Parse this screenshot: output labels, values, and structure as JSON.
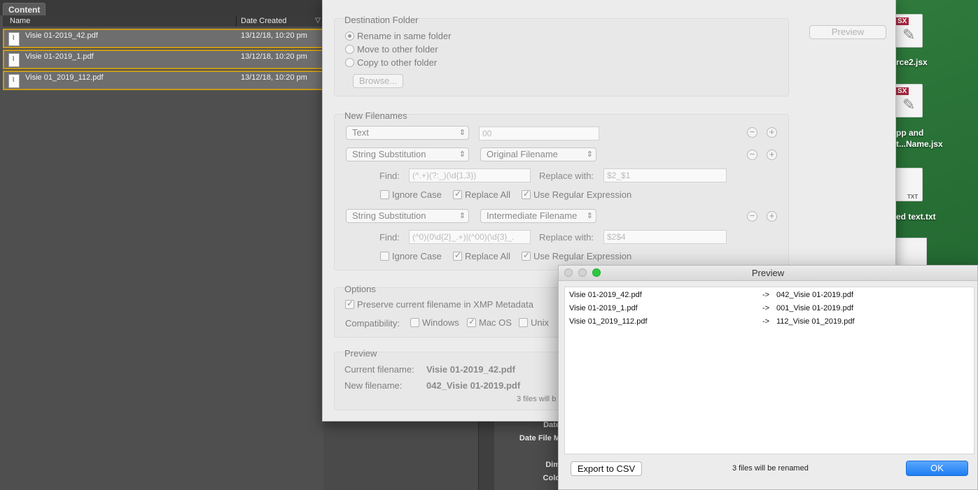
{
  "content_panel": {
    "tab": "Content",
    "columns": {
      "name": "Name",
      "date": "Date Created"
    },
    "files": [
      {
        "name": "Visie 01-2019_42.pdf",
        "date": "13/12/18, 10:20 pm"
      },
      {
        "name": "Visie 01-2019_1.pdf",
        "date": "13/12/18, 10:20 pm"
      },
      {
        "name": "Visie 01_2019_112.pdf",
        "date": "13/12/18, 10:20 pm"
      }
    ]
  },
  "rename_dialog": {
    "destination": {
      "title": "Destination Folder",
      "options": [
        "Rename in same folder",
        "Move to other folder",
        "Copy to other folder"
      ],
      "selected": "Rename in same folder",
      "browse_label": "Browse..."
    },
    "preview_button": "Preview",
    "new_filenames": {
      "title": "New Filenames",
      "rows": [
        {
          "element": "Text",
          "value": "00"
        },
        {
          "element": "String Substitution",
          "source": "Original Filename",
          "find_label": "Find:",
          "find": "(^.+)(?:_)(\\d{1,3})",
          "replace_label": "Replace with:",
          "replace": "$2_$1",
          "ignore_case": "Ignore Case",
          "replace_all": "Replace All",
          "use_regex": "Use Regular Expression"
        },
        {
          "element": "String Substitution",
          "source": "Intermediate Filename",
          "find_label": "Find:",
          "find": "(^0)(0\\d{2}_.+)|(^00)(\\d{3}_.",
          "replace_label": "Replace with:",
          "replace": "$2$4",
          "ignore_case": "Ignore Case",
          "replace_all": "Replace All",
          "use_regex": "Use Regular Expression"
        }
      ],
      "minus_symbol": "−",
      "plus_symbol": "+"
    },
    "options": {
      "title": "Options",
      "preserve_xmp": "Preserve current filename in XMP Metadata",
      "compatibility_label": "Compatibility:",
      "windows": "Windows",
      "macos": "Mac OS",
      "unix": "Unix"
    },
    "preview_section": {
      "title": "Preview",
      "current_label": "Current filename:",
      "current_value": "Visie 01-2019_42.pdf",
      "new_label": "New filename:",
      "new_value": "042_Visie 01-2019.pdf",
      "count_text": "3 files will b"
    }
  },
  "metadata_panel": {
    "labels": [
      "Date",
      "Date File M",
      "I",
      "Dim",
      "Colo"
    ]
  },
  "desktop": {
    "icons": [
      {
        "tag": "SX",
        "label": "rce2.jsx"
      },
      {
        "tag": "SX",
        "label_line1": "pp and",
        "label_line2": "t...Name.jsx"
      },
      {
        "tag": "TXT",
        "label": "ed text.txt"
      }
    ]
  },
  "preview_window": {
    "title": "Preview",
    "rows": [
      {
        "old": "Visie 01-2019_42.pdf",
        "arrow": "->",
        "new": "042_Visie 01-2019.pdf"
      },
      {
        "old": "Visie 01-2019_1.pdf",
        "arrow": "->",
        "new": "001_Visie 01-2019.pdf"
      },
      {
        "old": "Visie 01_2019_112.pdf",
        "arrow": "->",
        "new": "112_Visie 01_2019.pdf"
      }
    ],
    "export_label": "Export to CSV",
    "status": "3 files will be renamed",
    "ok_label": "OK"
  }
}
